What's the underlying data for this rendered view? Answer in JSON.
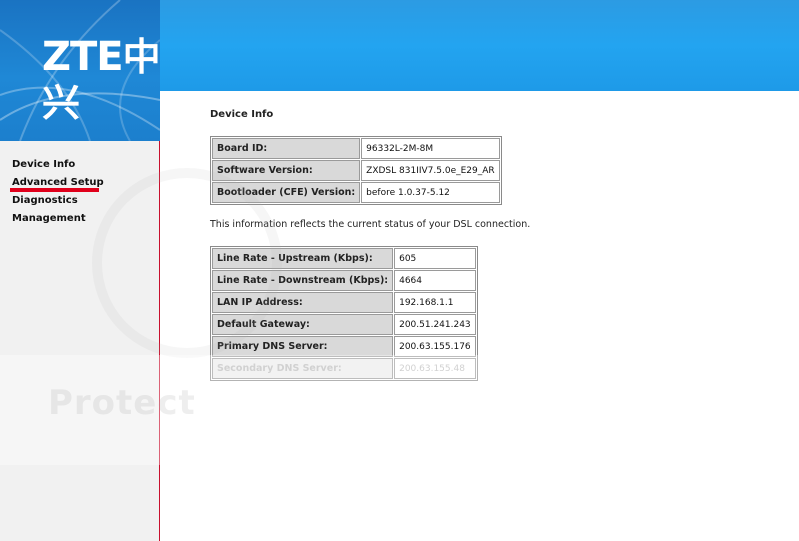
{
  "brand": {
    "logo_latin": "ZTE",
    "logo_cjk": "中兴"
  },
  "sidebar": {
    "items": [
      {
        "label": "Device Info"
      },
      {
        "label": "Advanced Setup"
      },
      {
        "label": "Diagnostics"
      },
      {
        "label": "Management"
      }
    ]
  },
  "main": {
    "title": "Device Info",
    "device_table": [
      {
        "label": "Board ID:",
        "value": "96332L-2M-8M"
      },
      {
        "label": "Software Version:",
        "value": "ZXDSL 831IIV7.5.0e_E29_AR"
      },
      {
        "label": "Bootloader (CFE) Version:",
        "value": "before 1.0.37-5.12"
      }
    ],
    "note": "This information reflects the current status of your DSL connection.",
    "dsl_table": [
      {
        "label": "Line Rate - Upstream (Kbps):",
        "value": "605"
      },
      {
        "label": "Line Rate - Downstream (Kbps):",
        "value": "4664"
      },
      {
        "label": "LAN IP Address:",
        "value": "192.168.1.1"
      },
      {
        "label": "Default Gateway:",
        "value": "200.51.241.243"
      },
      {
        "label": "Primary DNS Server:",
        "value": "200.63.155.176"
      },
      {
        "label": "Secondary DNS Server:",
        "value": "200.63.155.48"
      }
    ]
  },
  "watermark": {
    "text": "Protect"
  },
  "colors": {
    "banner_blue": "#23a4f0",
    "banner_dark_blue": "#1a73c2",
    "accent_red": "#e0001b",
    "label_cell_bg": "#d9d9d9"
  }
}
